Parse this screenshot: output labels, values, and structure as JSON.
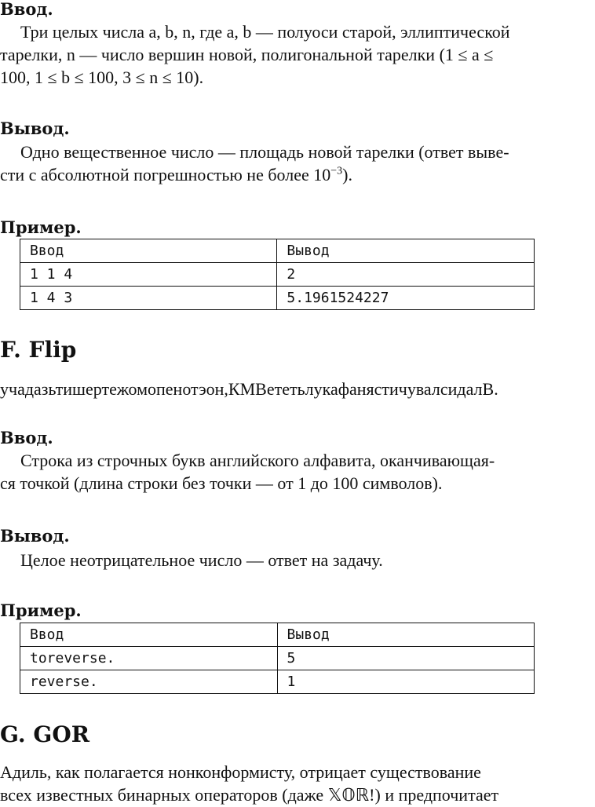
{
  "problem_e": {
    "input_heading": "Ввод.",
    "input_text": [
      "Три целых числа a, b, n, где a, b — полуоси старой, эллиптической",
      "тарелки, n — число вершин новой, полигональной тарелки (1 ≤ a ≤",
      "100, 1 ≤ b ≤ 100, 3 ≤ n ≤ 10)."
    ],
    "output_heading": "Вывод.",
    "output_text": [
      "Одно вещественное число — площадь новой тарелки (ответ выве-",
      "сти с абсолютной погрешностью не более 10",
      "−3",
      ")."
    ],
    "example_heading": "Пример.",
    "example_table": {
      "headers": [
        "Ввод",
        "Вывод"
      ],
      "rows": [
        [
          "1 1 4",
          "2"
        ],
        [
          "1 4 3",
          "5.1961524227"
        ]
      ]
    }
  },
  "problem_f": {
    "title": "F. Flip",
    "statement": "учадазьтишертежомопенотэон,КМВететьлукафанястичувалсидалВ.",
    "input_heading": "Ввод.",
    "input_text": [
      "Строка из строчных букв английского алфавита, оканчивающая-",
      "ся точкой (длина строки без точки — от 1 до 100 символов)."
    ],
    "output_heading": "Вывод.",
    "output_text": [
      "Целое неотрицательное число — ответ на задачу."
    ],
    "example_heading": "Пример.",
    "example_table": {
      "headers": [
        "Ввод",
        "Вывод"
      ],
      "rows": [
        [
          "toreverse.",
          "5"
        ],
        [
          "reverse.",
          "1"
        ]
      ]
    }
  },
  "problem_g": {
    "title": "G. GOR",
    "statement": [
      "Адиль, как полагается нонконформисту, отрицает существование",
      "всех известных бинарных операторов (даже 𝕏𝕆ℝ!) и предпочитает"
    ]
  }
}
